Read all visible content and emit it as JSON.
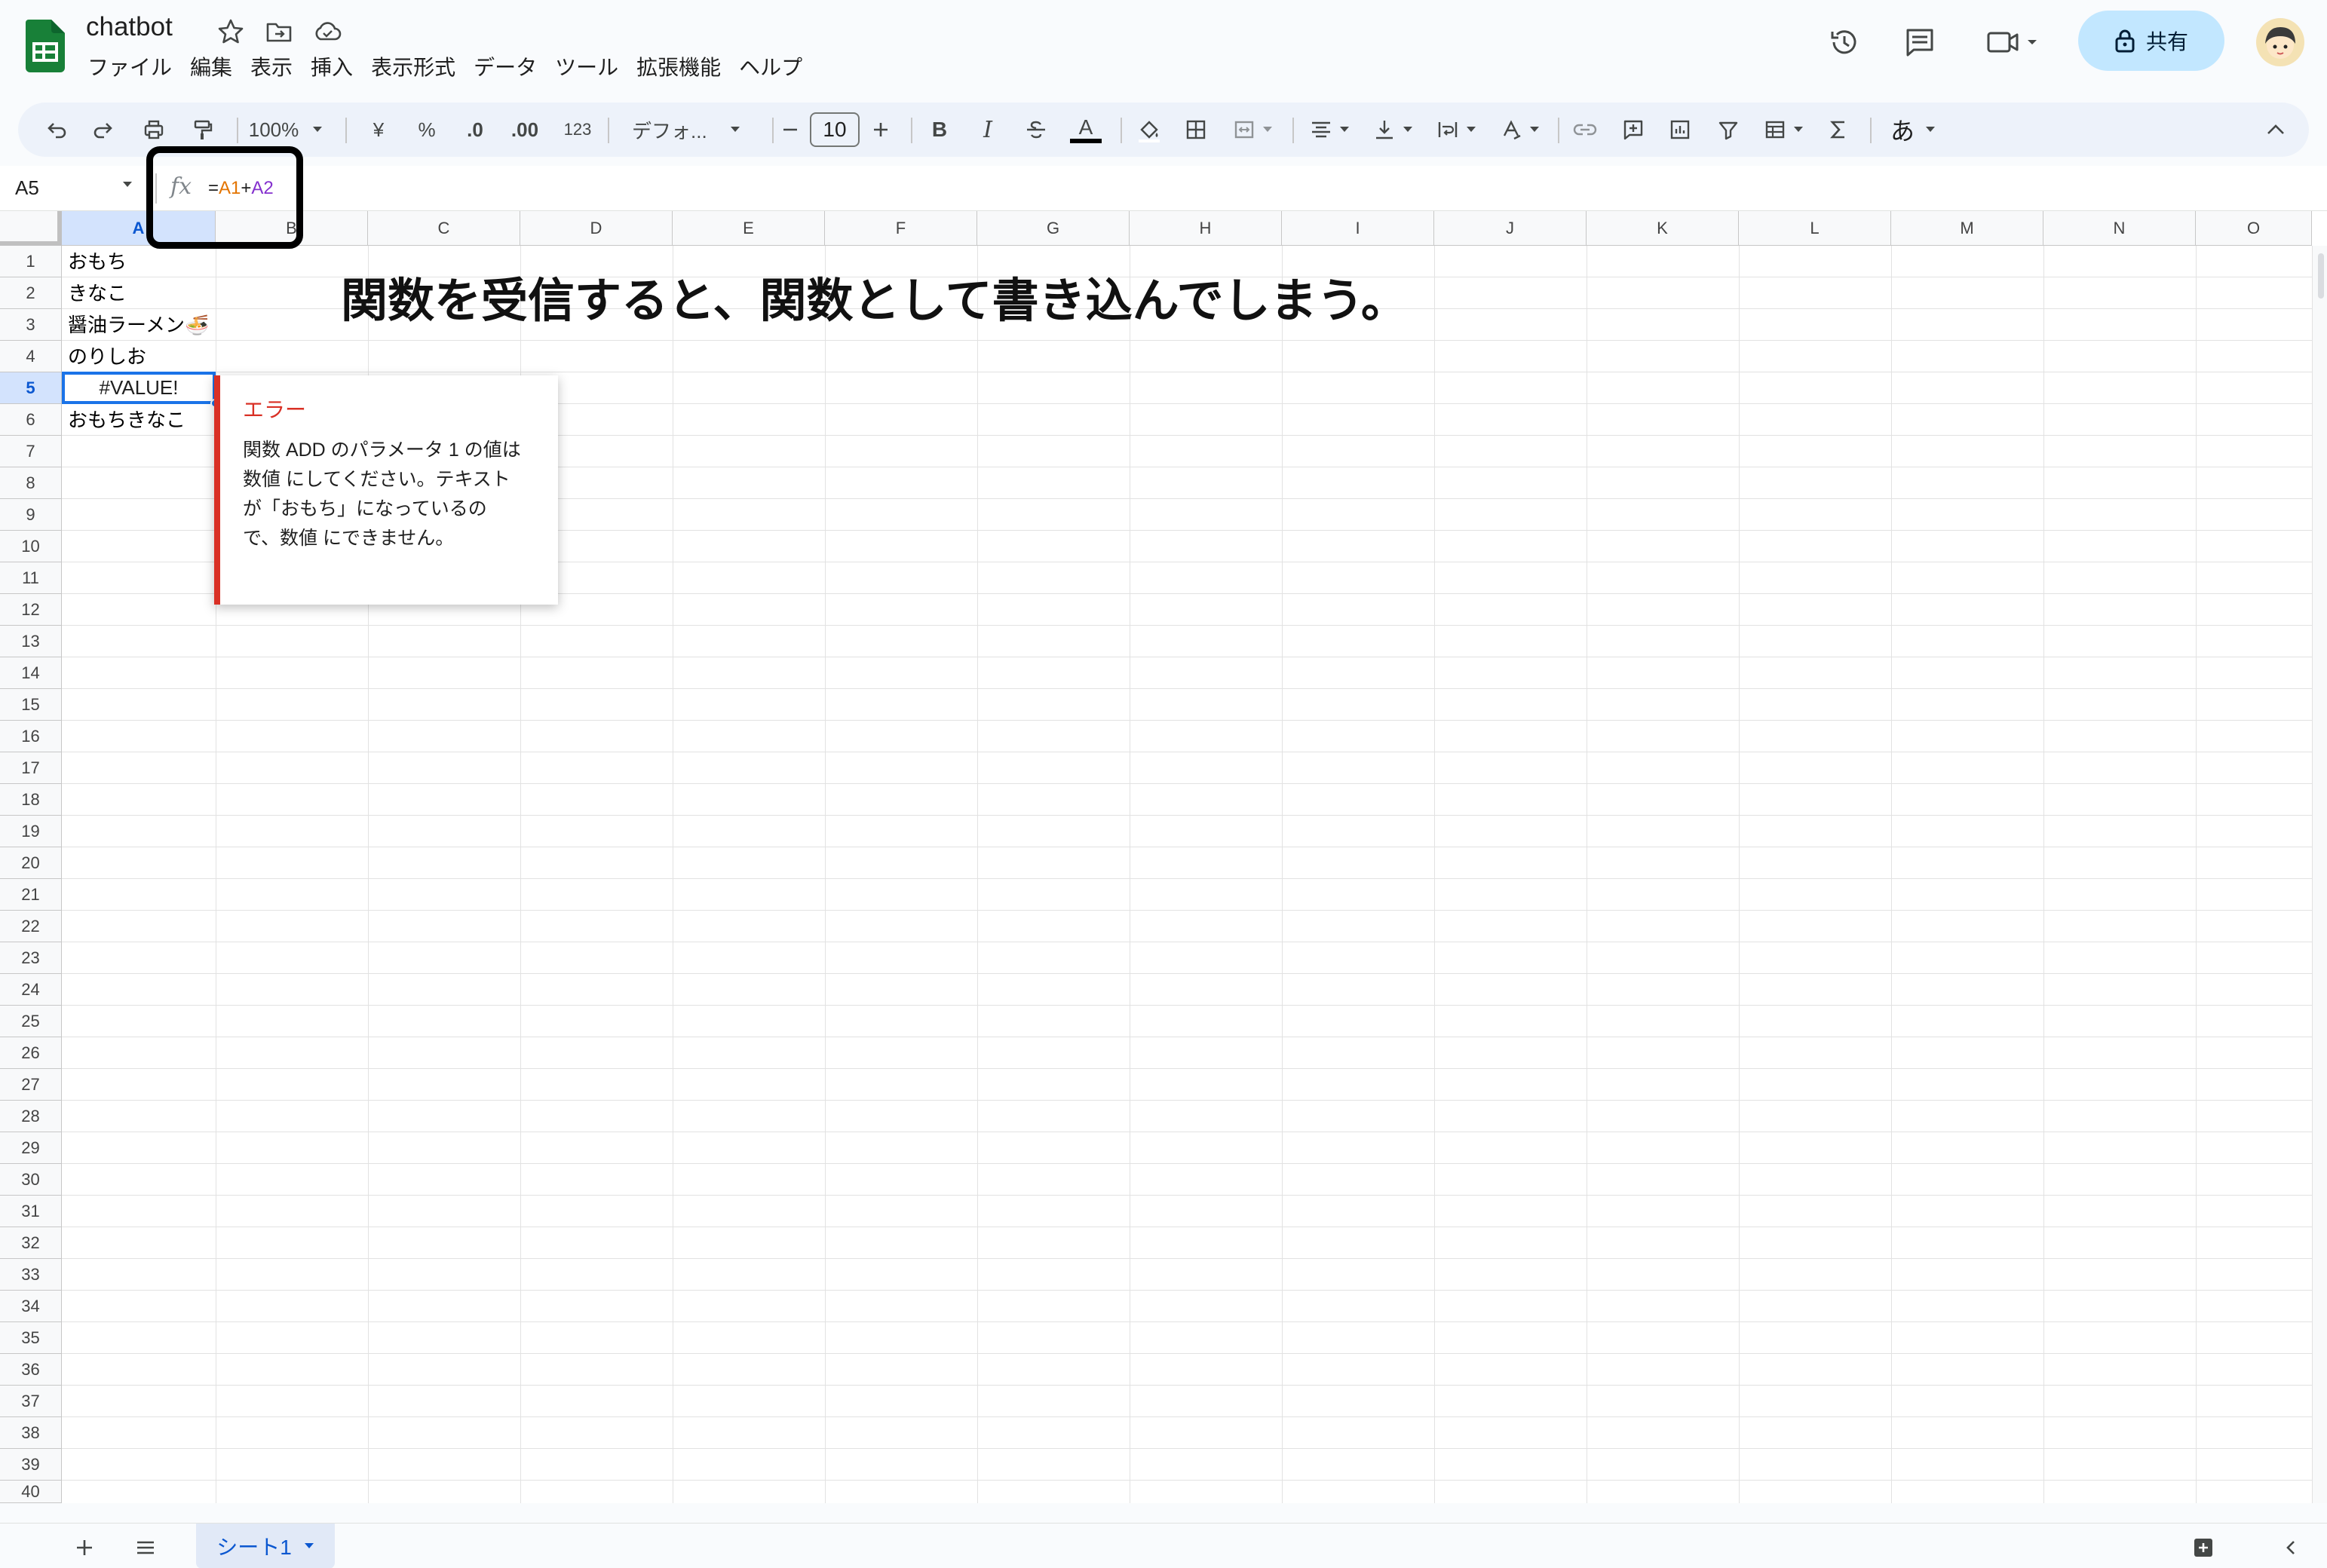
{
  "app": {
    "title": "chatbot",
    "share_label": "共有"
  },
  "menu": {
    "items": [
      "ファイル",
      "編集",
      "表示",
      "挿入",
      "表示形式",
      "データ",
      "ツール",
      "拡張機能",
      "ヘルプ"
    ]
  },
  "toolbar": {
    "zoom": "100%",
    "currency": "¥",
    "percent": "%",
    "decrease_decimal": ".0",
    "increase_decimal": ".00",
    "number_format": "123",
    "font": "デフォ...",
    "font_size": "10",
    "bold": "B",
    "italic": "I",
    "text_color": "A",
    "input_mode": "あ"
  },
  "formula_bar": {
    "name_box": "A5",
    "formula": "=A1+A2",
    "formula_prefix": "=",
    "ref1": "A1",
    "op": "+",
    "ref2": "A2",
    "ref1_color": "#e37400",
    "ref2_color": "#8430ce"
  },
  "grid": {
    "columns": [
      "A",
      "B",
      "C",
      "D",
      "E",
      "F",
      "G",
      "H",
      "I",
      "J",
      "K",
      "L",
      "M",
      "N",
      "O"
    ],
    "rows": [
      "1",
      "2",
      "3",
      "4",
      "5",
      "6",
      "7",
      "8",
      "9",
      "10",
      "11",
      "12",
      "13",
      "14",
      "15",
      "16",
      "17",
      "18",
      "19",
      "20",
      "21",
      "22",
      "23",
      "24",
      "25",
      "26",
      "27",
      "28",
      "29",
      "30",
      "31",
      "32",
      "33",
      "34",
      "35",
      "36",
      "37",
      "38",
      "39",
      "40"
    ],
    "selected_column": "A",
    "selected_row": "5",
    "cells": {
      "A1": "おもち",
      "A2": "きなこ",
      "A3": "醤油ラーメン🍜",
      "A4": "のりしお",
      "A5": "#VALUE!",
      "A6": "おもちきなこ"
    }
  },
  "annotation": "関数を受信すると、関数として書き込んでしまう。",
  "error_popup": {
    "title": "エラー",
    "message": "関数 ADD のパラメータ 1 の値は 数値 にしてください。テキスト が「おもち」になっているので、数値 にできません。"
  },
  "sheets": {
    "active_tab": "シート1"
  },
  "colors": {
    "accent": "#0b57d0",
    "share_bg": "#c2e7ff",
    "error": "#d93025",
    "sheets_green": "#188038"
  }
}
